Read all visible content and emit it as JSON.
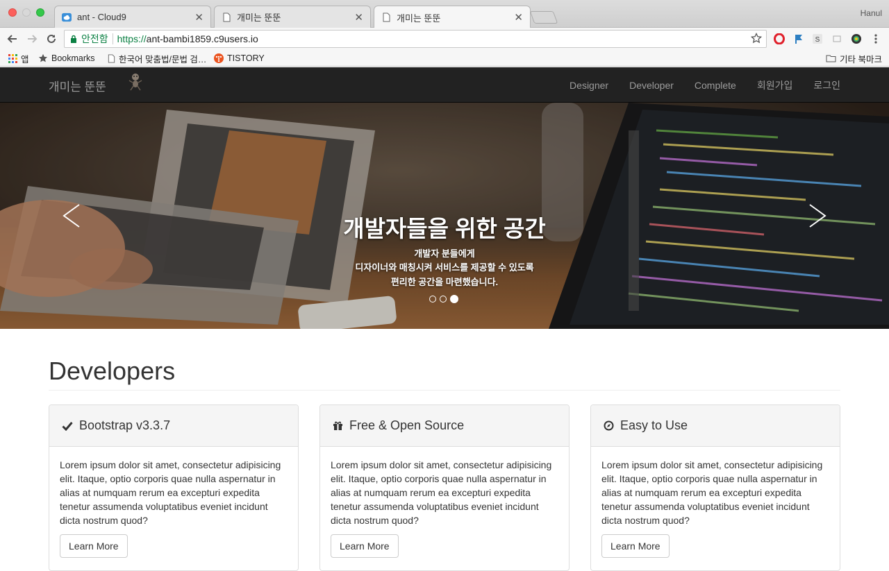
{
  "browser": {
    "tabs": [
      {
        "title": "ant - Cloud9",
        "icon": "cloud9-icon",
        "active": false
      },
      {
        "title": "개미는 뚠뚠",
        "icon": "page-icon",
        "active": false
      },
      {
        "title": "개미는 뚠뚠",
        "icon": "page-icon",
        "active": true
      }
    ],
    "profile_name": "Hanul",
    "security_label": "안전함",
    "url_scheme": "https://",
    "url_host": "ant-bambi1859.c9users.io",
    "bookmarks": [
      {
        "label": "앱",
        "icon": "apps-grid-icon"
      },
      {
        "label": "Bookmarks",
        "icon": "star-icon"
      },
      {
        "label": "한국어 맞춤법/문법 검…",
        "icon": "page-icon"
      },
      {
        "label": "TISTORY",
        "icon": "tistory-icon"
      }
    ],
    "other_bookmarks": "기타 북마크"
  },
  "site": {
    "brand": "개미는 뚠뚠",
    "nav": [
      "Designer",
      "Developer",
      "Complete",
      "회원가입",
      "로그인"
    ]
  },
  "hero": {
    "title": "개발자들을 위한 공간",
    "lines": [
      "개발자 분들에게",
      "디자이너와 매칭시켜 서비스를 제공할 수 있도록",
      "편리한 공간을 마련했습니다."
    ],
    "slide_count": 3,
    "active_slide": 3
  },
  "section": {
    "title": "Developers",
    "panels": [
      {
        "icon": "checkmark-icon",
        "heading": "Bootstrap v3.3.7",
        "text": "Lorem ipsum dolor sit amet, consectetur adipisicing elit. Itaque, optio corporis quae nulla aspernatur in alias at numquam rerum ea excepturi expedita tenetur assumenda voluptatibus eveniet incidunt dicta nostrum quod?",
        "button": "Learn More"
      },
      {
        "icon": "gift-icon",
        "heading": "Free & Open Source",
        "text": "Lorem ipsum dolor sit amet, consectetur adipisicing elit. Itaque, optio corporis quae nulla aspernatur in alias at numquam rerum ea excepturi expedita tenetur assumenda voluptatibus eveniet incidunt dicta nostrum quod?",
        "button": "Learn More"
      },
      {
        "icon": "compass-icon",
        "heading": "Easy to Use",
        "text": "Lorem ipsum dolor sit amet, consectetur adipisicing elit. Itaque, optio corporis quae nulla aspernatur in alias at numquam rerum ea excepturi expedita tenetur assumenda voluptatibus eveniet incidunt dicta nostrum quod?",
        "button": "Learn More"
      }
    ]
  },
  "colors": {
    "navbar_bg": "#222222",
    "nav_text": "#9d9d9d",
    "secure_green": "#0b8043",
    "panel_head_bg": "#f5f5f5"
  }
}
